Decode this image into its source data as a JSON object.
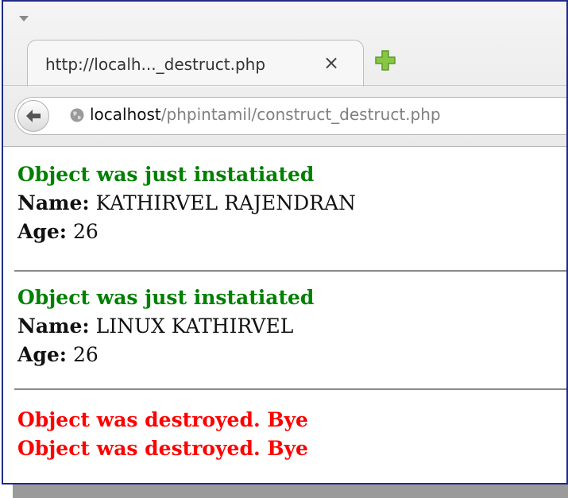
{
  "browser": {
    "tab": {
      "title": "http://localh..._destruct.php",
      "close_glyph": "×"
    },
    "new_tab_icon": "plus-icon",
    "address_bar": {
      "host": "localhost",
      "path": "/phpintamil/construct_destruct.php"
    },
    "colors": {
      "window_border": "#1f2a88",
      "new_tab_plus": "#88c743"
    }
  },
  "page": {
    "blocks": [
      {
        "status": "Object was just instatiated",
        "name_label": "Name:",
        "name_value": " KATHIRVEL RAJENDRAN",
        "age_label": "Age:",
        "age_value": " 26"
      },
      {
        "status": "Object was just instatiated",
        "name_label": "Name:",
        "name_value": " LINUX KATHIRVEL",
        "age_label": "Age:",
        "age_value": " 26"
      }
    ],
    "destroyed_messages": [
      "Object was destroyed. Bye",
      "Object was destroyed. Bye"
    ],
    "colors": {
      "created": "#008000",
      "destroyed": "#ff0000"
    }
  }
}
